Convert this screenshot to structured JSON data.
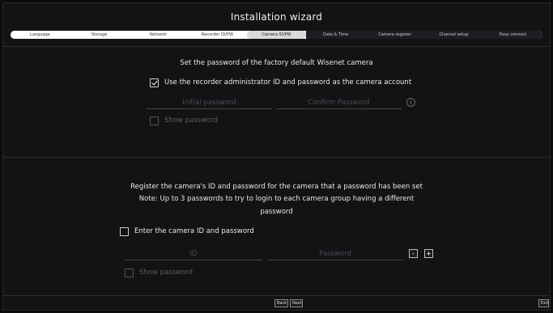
{
  "window": {
    "title": "Installation wizard"
  },
  "steps": [
    {
      "label": "Language",
      "state": "done"
    },
    {
      "label": "Storage",
      "state": "done"
    },
    {
      "label": "Network",
      "state": "done"
    },
    {
      "label": "Recorder ID/PW",
      "state": "done"
    },
    {
      "label": "Camera ID/PW",
      "state": "active"
    },
    {
      "label": "Date & Time",
      "state": "todo"
    },
    {
      "label": "Camera register",
      "state": "todo"
    },
    {
      "label": "Channel setup",
      "state": "todo"
    },
    {
      "label": "Easy connect",
      "state": "todo"
    }
  ],
  "factory": {
    "heading": "Set the password of the factory default Wisenet camera",
    "use_recorder_label": "Use the recorder administrator ID and password as the camera account",
    "use_recorder_checked": true,
    "initial_password_placeholder": "Initial password",
    "confirm_password_placeholder": "Confirm Password",
    "info_icon": "i",
    "show_password_label": "Show password"
  },
  "register": {
    "line1": "Register the camera's ID and password for the camera that a password has been set",
    "line2": "Note: Up to 3 passwords to try to login to each camera group having a different",
    "line3": "password",
    "enter_label": "Enter the camera ID and password",
    "id_placeholder": "ID",
    "password_placeholder": "Password",
    "minus_label": "-",
    "plus_label": "+",
    "show_password_label": "Show password"
  },
  "footer": {
    "back_label": "Back",
    "next_label": "Next",
    "exit_label": "Exit"
  }
}
